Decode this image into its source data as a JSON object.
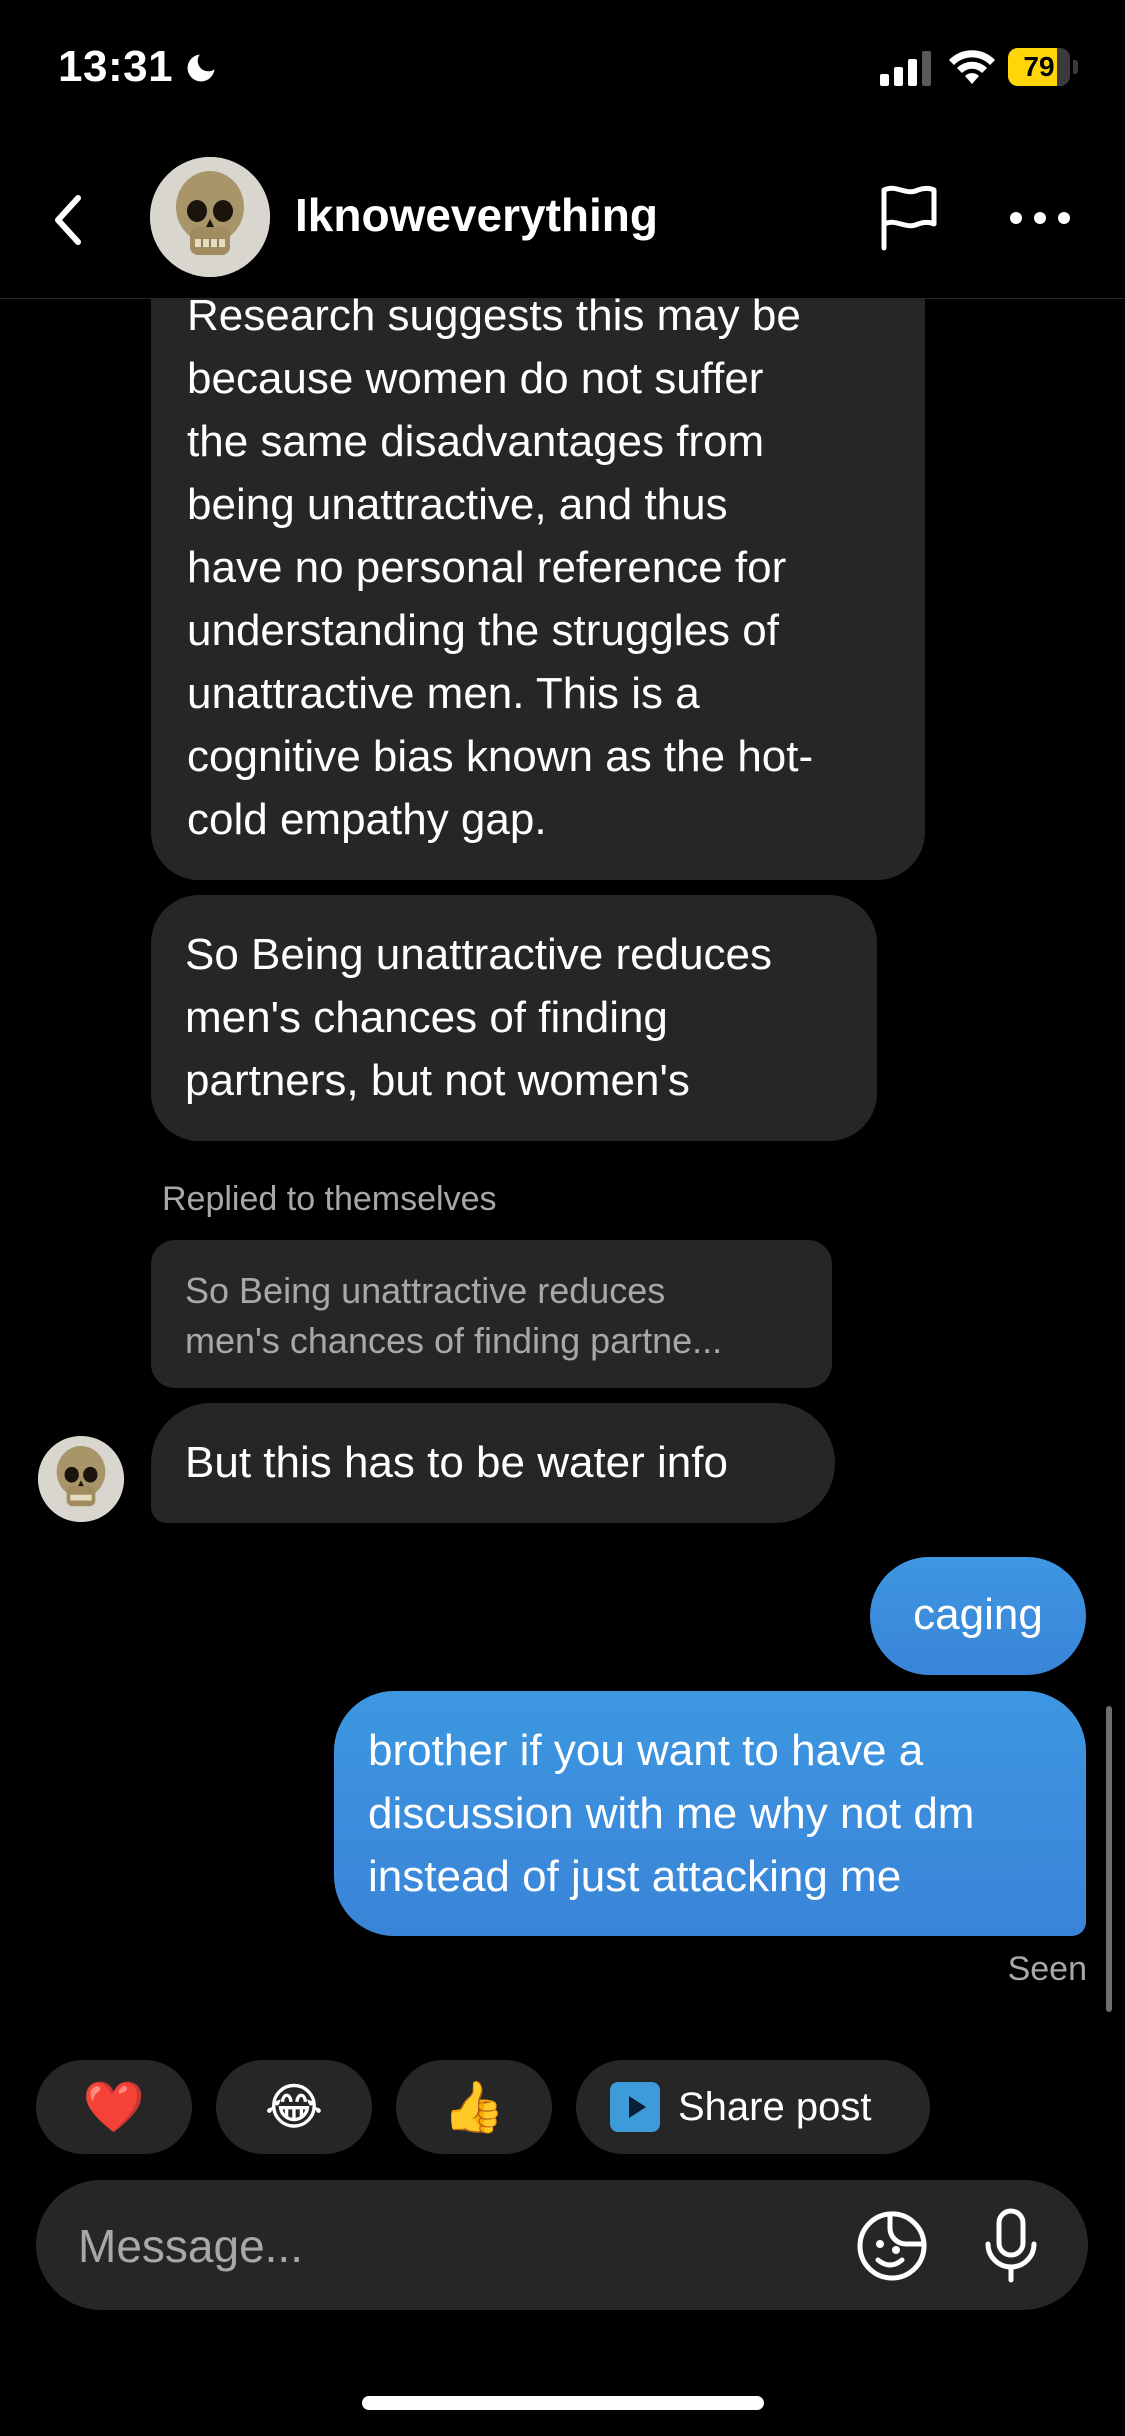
{
  "status_bar": {
    "time": "13:31",
    "battery_level": "79",
    "battery_fraction": 0.79,
    "battery_color": "#ffd60a",
    "icons": [
      "moon-icon",
      "signal-icon",
      "wifi-icon",
      "battery-icon"
    ]
  },
  "header": {
    "username": "Iknoweverything",
    "icons": [
      "back-chevron-icon",
      "skull-avatar",
      "flag-icon",
      "more-horizontal-icon"
    ]
  },
  "messages": [
    {
      "sender": "other",
      "lines": [
        "Research suggests this may be",
        "because women do not suffer",
        "the same disadvantages from",
        "being unattractive, and thus",
        "have no personal reference for",
        "understanding the struggles of",
        "unattractive men. This is a",
        "cognitive bias known as the hot-",
        "cold empathy gap."
      ]
    },
    {
      "sender": "other",
      "lines": [
        "So Being unattractive reduces",
        "men's chances of finding",
        "partners, but not women's"
      ]
    },
    {
      "sender": "other",
      "reply_label": "Replied to themselves",
      "quote_lines": [
        "So Being unattractive reduces",
        "men's chances of finding partne..."
      ],
      "lines": [
        "But this has to be water info"
      ]
    },
    {
      "sender": "me",
      "lines": [
        "caging"
      ]
    },
    {
      "sender": "me",
      "lines": [
        "brother if you want to have a",
        "discussion with me why not dm",
        "instead of just attacking me"
      ]
    }
  ],
  "seen_label": "Seen",
  "quick_reactions": {
    "heart": "❤️",
    "laugh": "😂",
    "thumbs_up": "👍",
    "share_label": "Share post"
  },
  "composer": {
    "placeholder": "Message...",
    "value": ""
  },
  "colors": {
    "background": "#000000",
    "incoming_bubble": "#262626",
    "outgoing_bubble": "#3a8fdc",
    "muted_text": "#a8a8a8"
  }
}
